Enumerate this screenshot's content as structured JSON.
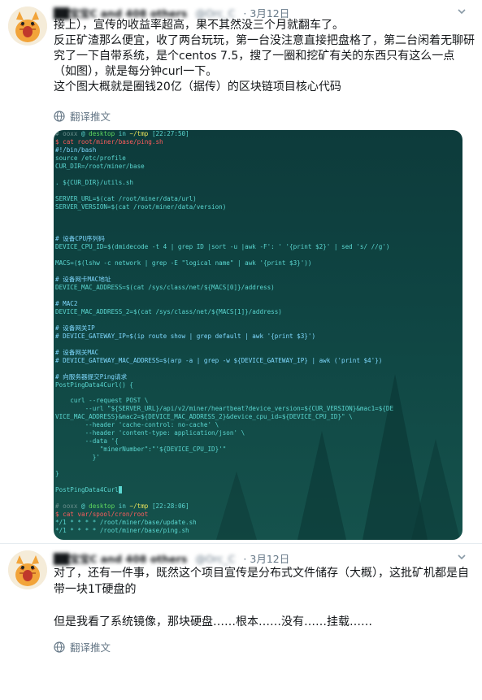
{
  "tweets": [
    {
      "author": "██宝宝C and 408 others",
      "handle": "@Orc_C",
      "date": "3月12日",
      "paragraphs": [
        "接上），宣传的收益率超高，果不其然没三个月就翻车了。",
        "反正矿渣那么便宜，收了两台玩玩，第一台没注意直接把盘格了，第二台闲着无聊研究了一下自带系统，是个centos 7.5，搜了一圈和挖矿有关的东西只有这么一点（如图），就是每分钟curl一下。",
        "这个图大概就是圈钱20亿（据传）的区块链项目核心代码"
      ],
      "translate": "翻译推文"
    },
    {
      "author": "██宝宝C and 408 others",
      "handle": "@Orc_C",
      "date": "3月12日",
      "paragraphs": [
        "对了，还有一件事，既然这个项目宣传是分布式文件储存（大概），这批矿机都是自带一块1T硬盘的",
        "",
        "但是我看了系统镜像，那块硬盘……根本……没有……挂载……"
      ],
      "translate": "翻译推文"
    }
  ],
  "terminal": {
    "prompt1_user": "# ooxx",
    "prompt_at": "@",
    "prompt_host": "desktop",
    "prompt_in": "in",
    "prompt1_dir": "~/tmp",
    "prompt1_time": "[22:27:50]",
    "cmd1": "$ cat root/miner/base/ping.sh",
    "script": [
      "#!/bin/bash",
      "source /etc/profile",
      "CUR_DIR=/root/miner/base",
      "",
      ". ${CUR_DIR}/utils.sh",
      "",
      "SERVER_URL=$(cat /root/miner/data/url)",
      "SERVER_VERSION=$(cat /root/miner/data/version)",
      "",
      "",
      "",
      "# 设备CPU序列码",
      "DEVICE_CPU_ID=$(dmidecode -t 4 | grep ID |sort -u |awk -F': ' '{print $2}' | sed 's/ //g')",
      "",
      "MACS=($(lshw -c network | grep -E \"logical name\" | awk '{print $3}'))",
      "",
      "# 设备网卡MAC地址",
      "DEVICE_MAC_ADDRESS=$(cat /sys/class/net/${MACS[0]}/address)",
      "",
      "# MAC2",
      "DEVICE_MAC_ADDRESS_2=$(cat /sys/class/net/${MACS[1]}/address)",
      "",
      "# 设备网关IP",
      "# DEVICE_GATEWAY_IP=$(ip route show | grep default | awk '{print $3}')",
      "",
      "# 设备网关MAC",
      "# DEVICE_GATEWAY_MAC_ADDRESS=$(arp -a | grep -w ${DEVICE_GATEWAY_IP} | awk ('print $4'})",
      "",
      "# 向服务器提交Ping请求",
      "PostPingData4Curl() {",
      "",
      "    curl --request POST \\",
      "        --url \"${SERVER_URL}/api/v2/miner/heartbeat?device_version=${CUR_VERSION}&mac1=${DE",
      "VICE_MAC_ADDRESS}&mac2=${DEVICE_MAC_ADDRESS_2}&device_cpu_id=${DEVICE_CPU_ID}\" \\",
      "        --header 'cache-control: no-cache' \\",
      "        --header 'content-type: application/json' \\",
      "        --data '{",
      "            \"minerNumber\":\"'${DEVICE_CPU_ID}'\"",
      "          }'",
      "",
      "}",
      "",
      "PostPingData4Curl"
    ],
    "prompt2_time": "[22:28:06]",
    "cmd2": "$ cat var/spool/cron/root",
    "cron": [
      "*/1 * * * * /root/miner/base/update.sh",
      "*/1 * * * * /root/miner/base/ping.sh"
    ]
  },
  "colors": {
    "divider": "#e6ecf0",
    "secondary_text": "#657786",
    "terminal_text": "#5ad6d0",
    "terminal_bg": "#0f4543"
  },
  "icons": [
    "avatar-cat",
    "chevron-down-icon",
    "globe-icon"
  ]
}
